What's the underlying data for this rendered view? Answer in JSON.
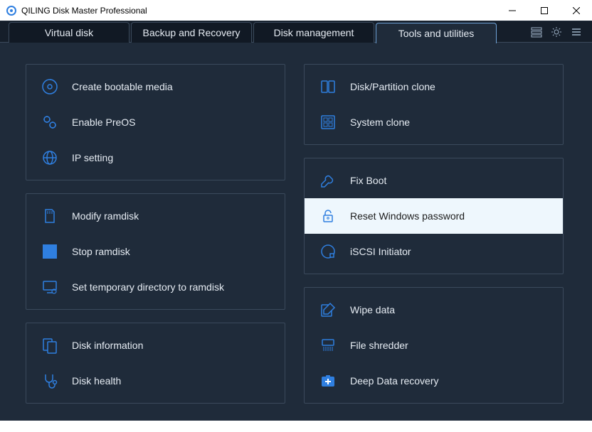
{
  "window": {
    "title": "QILING Disk Master Professional"
  },
  "tabs": [
    {
      "label": "Virtual disk",
      "active": false
    },
    {
      "label": "Backup and Recovery",
      "active": false
    },
    {
      "label": "Disk management",
      "active": false
    },
    {
      "label": "Tools and utilities",
      "active": true
    }
  ],
  "left_column": [
    {
      "items": [
        {
          "icon": "disc",
          "label": "Create bootable media"
        },
        {
          "icon": "gears",
          "label": "Enable PreOS"
        },
        {
          "icon": "globe",
          "label": "IP setting"
        }
      ]
    },
    {
      "items": [
        {
          "icon": "sdcard",
          "label": "Modify ramdisk"
        },
        {
          "icon": "square",
          "label": "Stop ramdisk"
        },
        {
          "icon": "monitor-gear",
          "label": "Set temporary directory to ramdisk"
        }
      ]
    },
    {
      "items": [
        {
          "icon": "disk-info",
          "label": "Disk information"
        },
        {
          "icon": "stethoscope",
          "label": "Disk health"
        }
      ]
    }
  ],
  "right_column": [
    {
      "items": [
        {
          "icon": "partition",
          "label": "Disk/Partition clone"
        },
        {
          "icon": "system",
          "label": "System clone"
        }
      ]
    },
    {
      "items": [
        {
          "icon": "wrench",
          "label": "Fix Boot"
        },
        {
          "icon": "lock",
          "label": "Reset Windows password",
          "selected": true
        },
        {
          "icon": "ring",
          "label": "iSCSI Initiator"
        }
      ]
    },
    {
      "items": [
        {
          "icon": "edit",
          "label": "Wipe data"
        },
        {
          "icon": "shredder",
          "label": "File shredder"
        },
        {
          "icon": "recovery",
          "label": "Deep Data recovery"
        }
      ]
    }
  ]
}
